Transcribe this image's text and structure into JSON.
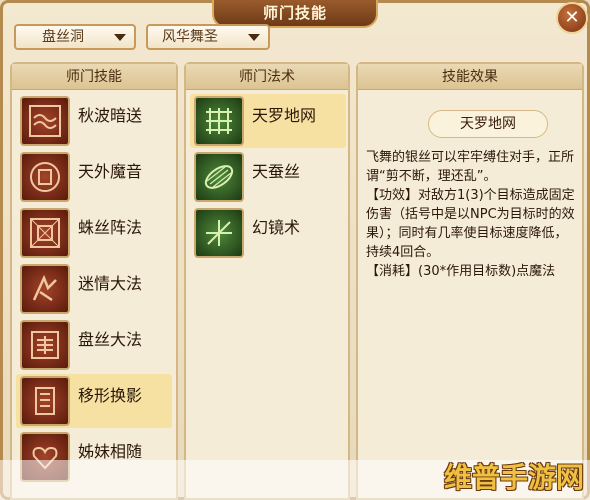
{
  "window": {
    "title": "师门技能",
    "close_symbol": "✕"
  },
  "filters": {
    "sect": "盘丝洞",
    "school": "风华舞圣"
  },
  "panels": {
    "skills_header": "师门技能",
    "spells_header": "师门法术",
    "effect_header": "技能效果"
  },
  "skills": [
    {
      "label": "秋波暗送",
      "icon": "wave-rune-icon"
    },
    {
      "label": "天外魔音",
      "icon": "bell-rune-icon"
    },
    {
      "label": "蛛丝阵法",
      "icon": "web-square-icon"
    },
    {
      "label": "迷情大法",
      "icon": "charm-rune-icon"
    },
    {
      "label": "盘丝大法",
      "icon": "spiral-rune-icon"
    },
    {
      "label": "移形换影",
      "icon": "shadow-rune-icon",
      "selected": true
    },
    {
      "label": "姊妹相随",
      "icon": "heart-rune-icon"
    }
  ],
  "spells": [
    {
      "label": "天罗地网",
      "icon": "net-icon",
      "selected": true
    },
    {
      "label": "天蚕丝",
      "icon": "silk-cocoon-icon"
    },
    {
      "label": "幻镜术",
      "icon": "mirror-icon"
    }
  ],
  "effect": {
    "title": "天罗地网",
    "text": "飞舞的银丝可以牢牢缚住对手，正所谓“剪不断，理还乱”。\n【功效】对敌方1(3)个目标造成固定伤害（括号中是以NPC为目标时的效果）；同时有几率使目标速度降低，持续4回合。\n【消耗】(30*作用目标数)点魔法"
  },
  "watermark": "维普手游网",
  "colors": {
    "accent": "#b48a4e",
    "selected_row": "#f6e0a2"
  }
}
